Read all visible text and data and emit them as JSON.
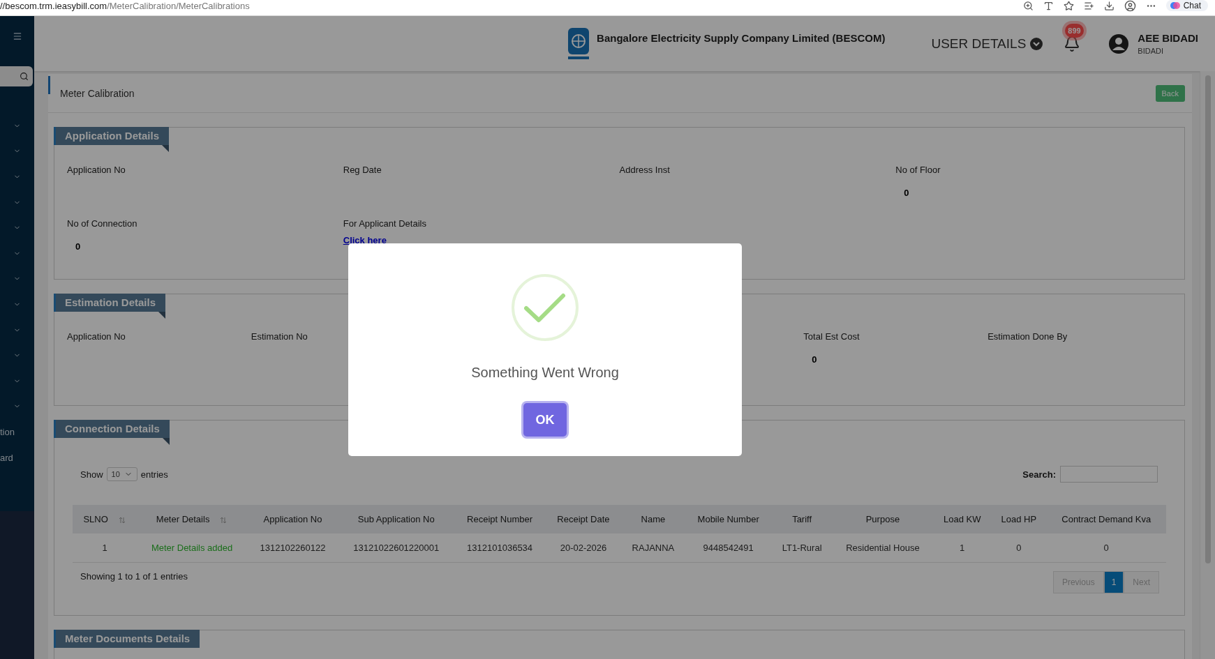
{
  "browser": {
    "url_host": "//bescom.trm.ieasybill.com",
    "url_path": "/MeterCalibration/MeterCalibrations",
    "chat": "Chat"
  },
  "sidebar": {
    "items": [
      {
        "kind": "group",
        "expanded": false
      },
      {
        "kind": "group",
        "expanded": false
      },
      {
        "kind": "group",
        "expanded": false
      },
      {
        "kind": "group",
        "expanded": false
      },
      {
        "kind": "group",
        "expanded": false
      },
      {
        "kind": "group",
        "expanded": false
      },
      {
        "kind": "group",
        "expanded": false
      },
      {
        "kind": "group",
        "expanded": false
      },
      {
        "kind": "group",
        "expanded": false
      },
      {
        "kind": "group",
        "expanded": false
      },
      {
        "kind": "group",
        "expanded": false
      },
      {
        "kind": "group",
        "expanded": false
      },
      {
        "kind": "link",
        "label": "tion"
      },
      {
        "kind": "link",
        "label": "ard"
      }
    ]
  },
  "header": {
    "company": "Bangalore Electricity Supply Company Limited (BESCOM)",
    "user_menu": "USER DETAILS",
    "notification_count": "899",
    "user_name": "AEE BIDADI",
    "user_location": "BIDADI"
  },
  "page": {
    "title": "Meter Calibration",
    "back": "Back"
  },
  "application_details": {
    "title": "Application Details",
    "fields": [
      {
        "label": "Application No"
      },
      {
        "label": "Reg Date"
      },
      {
        "label": "Address Inst"
      },
      {
        "label": "No of Floor",
        "value": "0"
      },
      {
        "label": "No of Connection",
        "value": "0"
      },
      {
        "label": "For Applicant Details",
        "link": "Click here"
      }
    ]
  },
  "estimation_details": {
    "title": "Estimation Details",
    "fields": [
      {
        "label": "Application No"
      },
      {
        "label": "Estimation No"
      },
      {
        "label": "Total Est Cost",
        "value": "0"
      },
      {
        "label": "Estimation Done By"
      }
    ]
  },
  "connection_details": {
    "title": "Connection Details",
    "show": "Show",
    "page_size": "10",
    "entries": "entries",
    "search_label": "Search:",
    "columns": [
      {
        "label": "SLNO",
        "sortable": true,
        "kind": "text"
      },
      {
        "label": "Meter Details",
        "sortable": true,
        "kind": "status"
      },
      {
        "label": "Application No",
        "sortable": false,
        "kind": "text"
      },
      {
        "label": "Sub Application No",
        "sortable": false,
        "kind": "text"
      },
      {
        "label": "Receipt Number",
        "sortable": false,
        "kind": "text"
      },
      {
        "label": "Receipt Date",
        "sortable": false,
        "kind": "text"
      },
      {
        "label": "Name",
        "sortable": false,
        "kind": "text"
      },
      {
        "label": "Mobile Number",
        "sortable": false,
        "kind": "text"
      },
      {
        "label": "Tariff",
        "sortable": false,
        "kind": "text"
      },
      {
        "label": "Purpose",
        "sortable": false,
        "kind": "text"
      },
      {
        "label": "Load KW",
        "sortable": false,
        "kind": "text"
      },
      {
        "label": "Load HP",
        "sortable": false,
        "kind": "text"
      },
      {
        "label": "Contract Demand Kva",
        "sortable": false,
        "kind": "text"
      }
    ],
    "rows": [
      [
        "1",
        "Meter Details added",
        "1312102260122",
        "13121022601220001",
        "1312101036534",
        "20-02-2026",
        "RAJANNA",
        "9448542491",
        "LT1-Rural",
        "Residential House",
        "1",
        "0",
        "0"
      ]
    ],
    "info": "Showing 1 to 1 of 1 entries",
    "pagination": {
      "previous": {
        "label": "Previous",
        "disabled": true
      },
      "pages": [
        {
          "label": "1",
          "selected": true
        }
      ],
      "next": {
        "label": "Next",
        "disabled": true
      }
    }
  },
  "meter_documents": {
    "title": "Meter Documents Details"
  },
  "dialog": {
    "message": "Something Went Wrong",
    "button": "OK"
  }
}
